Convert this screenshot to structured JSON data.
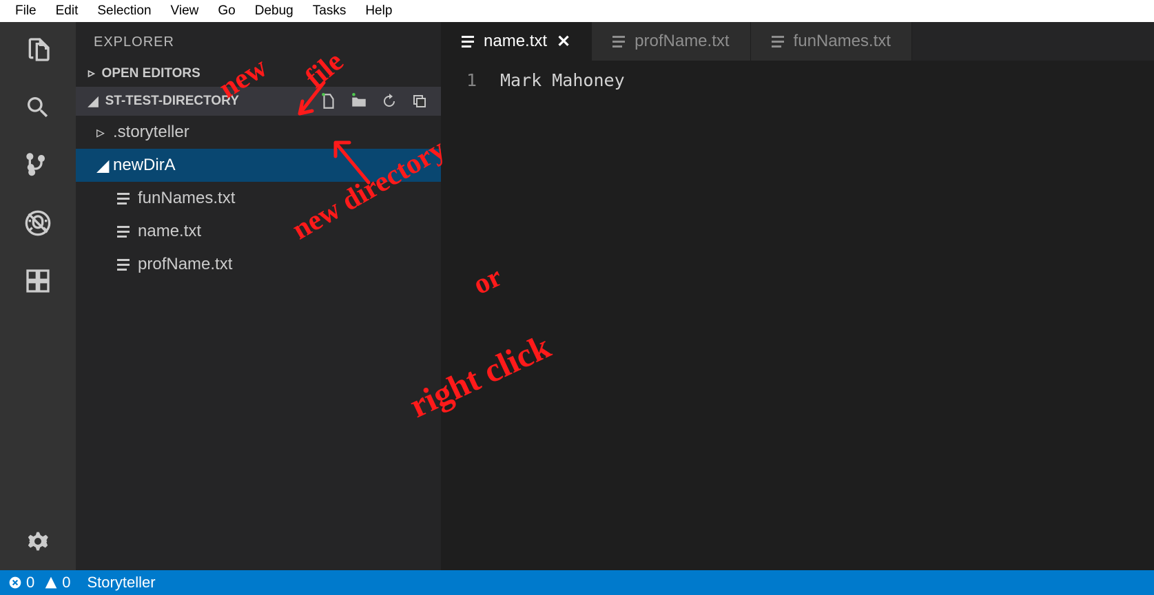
{
  "menubar": {
    "items": [
      "File",
      "Edit",
      "Selection",
      "View",
      "Go",
      "Debug",
      "Tasks",
      "Help"
    ]
  },
  "sidebar": {
    "title": "EXPLORER",
    "open_editors_label": "OPEN EDITORS",
    "workspace_label": "ST-TEST-DIRECTORY",
    "tree": [
      {
        "label": ".storyteller"
      },
      {
        "label": "newDirA"
      },
      {
        "label": "funNames.txt"
      },
      {
        "label": "name.txt"
      },
      {
        "label": "profName.txt"
      }
    ]
  },
  "tabs": [
    {
      "label": "name.txt",
      "active": true
    },
    {
      "label": "profName.txt",
      "active": false
    },
    {
      "label": "funNames.txt",
      "active": false
    }
  ],
  "editor": {
    "line_number": "1",
    "content": "Mark Mahoney"
  },
  "statusbar": {
    "errors": "0",
    "warnings": "0",
    "extension": "Storyteller"
  },
  "annotations": {
    "new": "new",
    "file": "file",
    "new_directory": "new directory",
    "or": "or",
    "right_click": "right click"
  }
}
